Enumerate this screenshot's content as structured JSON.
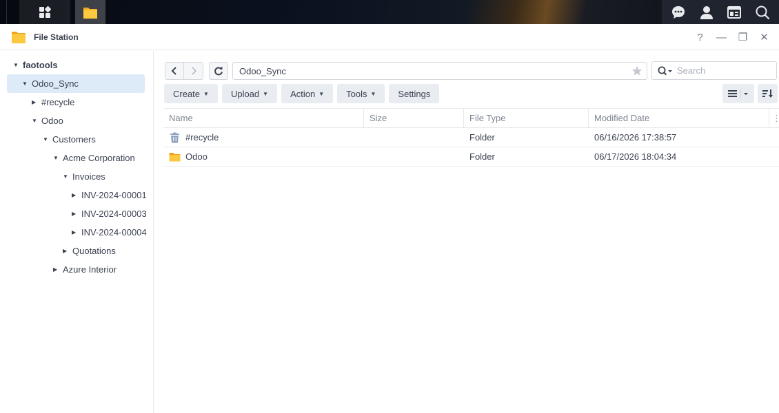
{
  "window": {
    "title": "File Station"
  },
  "window_controls": {
    "help": "?",
    "minimize": "—",
    "restore": "❐",
    "close": "✕"
  },
  "sidebar": {
    "items": [
      {
        "label": "faotools",
        "level": 0,
        "expanded": true
      },
      {
        "label": "Odoo_Sync",
        "level": 1,
        "expanded": true,
        "selected": true
      },
      {
        "label": "#recycle",
        "level": 2,
        "expanded": false
      },
      {
        "label": "Odoo",
        "level": 2,
        "expanded": true
      },
      {
        "label": "Customers",
        "level": 3,
        "expanded": true
      },
      {
        "label": "Acme Corporation",
        "level": 4,
        "expanded": true
      },
      {
        "label": "Invoices",
        "level": 5,
        "expanded": true
      },
      {
        "label": "INV-2024-00001",
        "level": 6,
        "expanded": false
      },
      {
        "label": "INV-2024-00003",
        "level": 6,
        "expanded": false
      },
      {
        "label": "INV-2024-00004",
        "level": 6,
        "expanded": false
      },
      {
        "label": "Quotations",
        "level": 5,
        "expanded": false
      },
      {
        "label": "Azure Interior",
        "level": 4,
        "expanded": false
      }
    ]
  },
  "path": {
    "current": "Odoo_Sync"
  },
  "search": {
    "placeholder": "Search"
  },
  "toolbar": {
    "create": "Create",
    "upload": "Upload",
    "action": "Action",
    "tools": "Tools",
    "settings": "Settings"
  },
  "table": {
    "columns": {
      "name": "Name",
      "size": "Size",
      "type": "File Type",
      "date": "Modified Date"
    },
    "rows": [
      {
        "name": "#recycle",
        "size": "",
        "type": "Folder",
        "date": "06/16/2026 17:38:57",
        "icon": "recycle-bin-icon"
      },
      {
        "name": "Odoo",
        "size": "",
        "type": "Folder",
        "date": "06/17/2026 18:04:34",
        "icon": "folder-icon"
      }
    ]
  },
  "colors": {
    "selected_bg": "#ddeaf7",
    "folder": "#f6b73c",
    "accent": "#2b78c5"
  }
}
